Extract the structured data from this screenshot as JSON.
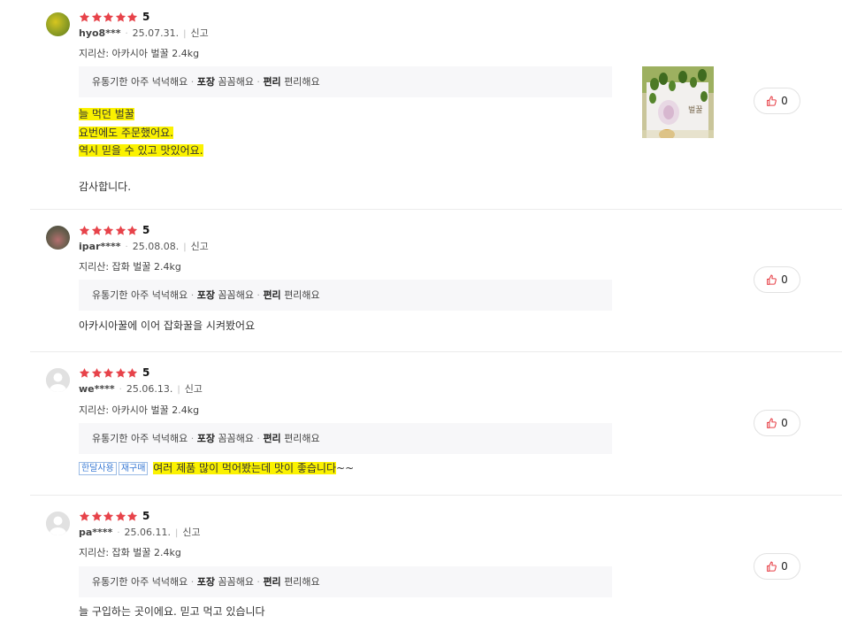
{
  "colors": {
    "star": "#e7434a",
    "highlight": "#fbf200",
    "thumb_icon": "#e7434a",
    "tag_blue": "#3a7bd5"
  },
  "reviews": [
    {
      "rating": "5",
      "stars": 5,
      "user": "hyo8***",
      "date": "25.07.31.",
      "report": "신고",
      "option": "지리산: 아카시아 벌꿀 2.4kg",
      "attrs": {
        "k1": "유통기한",
        "v1": "아주 넉넉해요",
        "k2": "포장",
        "v2": "꼼꼼해요",
        "k3": "편리",
        "v3": "편리해요"
      },
      "lines": [
        "늘 먹던 벌꿀",
        "요번에도 주문했어요.",
        "역시 믿을 수 있고 맛있어요.",
        "",
        "감사합니다."
      ],
      "likes": "0"
    },
    {
      "rating": "5",
      "stars": 5,
      "user": "ipar****",
      "date": "25.08.08.",
      "report": "신고",
      "option": "지리산: 잡화 벌꿀 2.4kg",
      "attrs": {
        "k1": "유통기한",
        "v1": "아주 넉넉해요",
        "k2": "포장",
        "v2": "꼼꼼해요",
        "k3": "편리",
        "v3": "편리해요"
      },
      "text": "아카시아꿀에 이어 잡화꿀을 시켜봤어요",
      "likes": "0"
    },
    {
      "rating": "5",
      "stars": 5,
      "user": "we****",
      "date": "25.06.13.",
      "report": "신고",
      "option": "지리산: 아카시아 벌꿀 2.4kg",
      "attrs": {
        "k1": "유통기한",
        "v1": "아주 넉넉해요",
        "k2": "포장",
        "v2": "꼼꼼해요",
        "k3": "편리",
        "v3": "편리해요"
      },
      "tags": [
        "한달사용",
        "재구매"
      ],
      "text": "여러 제품 많이 먹어봤는데 맛이 좋습니다",
      "text_tail": "~~",
      "likes": "0"
    },
    {
      "rating": "5",
      "stars": 5,
      "user": "pa****",
      "date": "25.06.11.",
      "report": "신고",
      "option": "지리산: 잡화 벌꿀 2.4kg",
      "attrs": {
        "k1": "유통기한",
        "v1": "아주 넉넉해요",
        "k2": "포장",
        "v2": "꼼꼼해요",
        "k3": "편리",
        "v3": "편리해요"
      },
      "text": "늘 구입하는 곳이에요. 믿고 먹고  있습니다",
      "likes": "0"
    }
  ],
  "photo": {
    "label": "벌꿀"
  }
}
